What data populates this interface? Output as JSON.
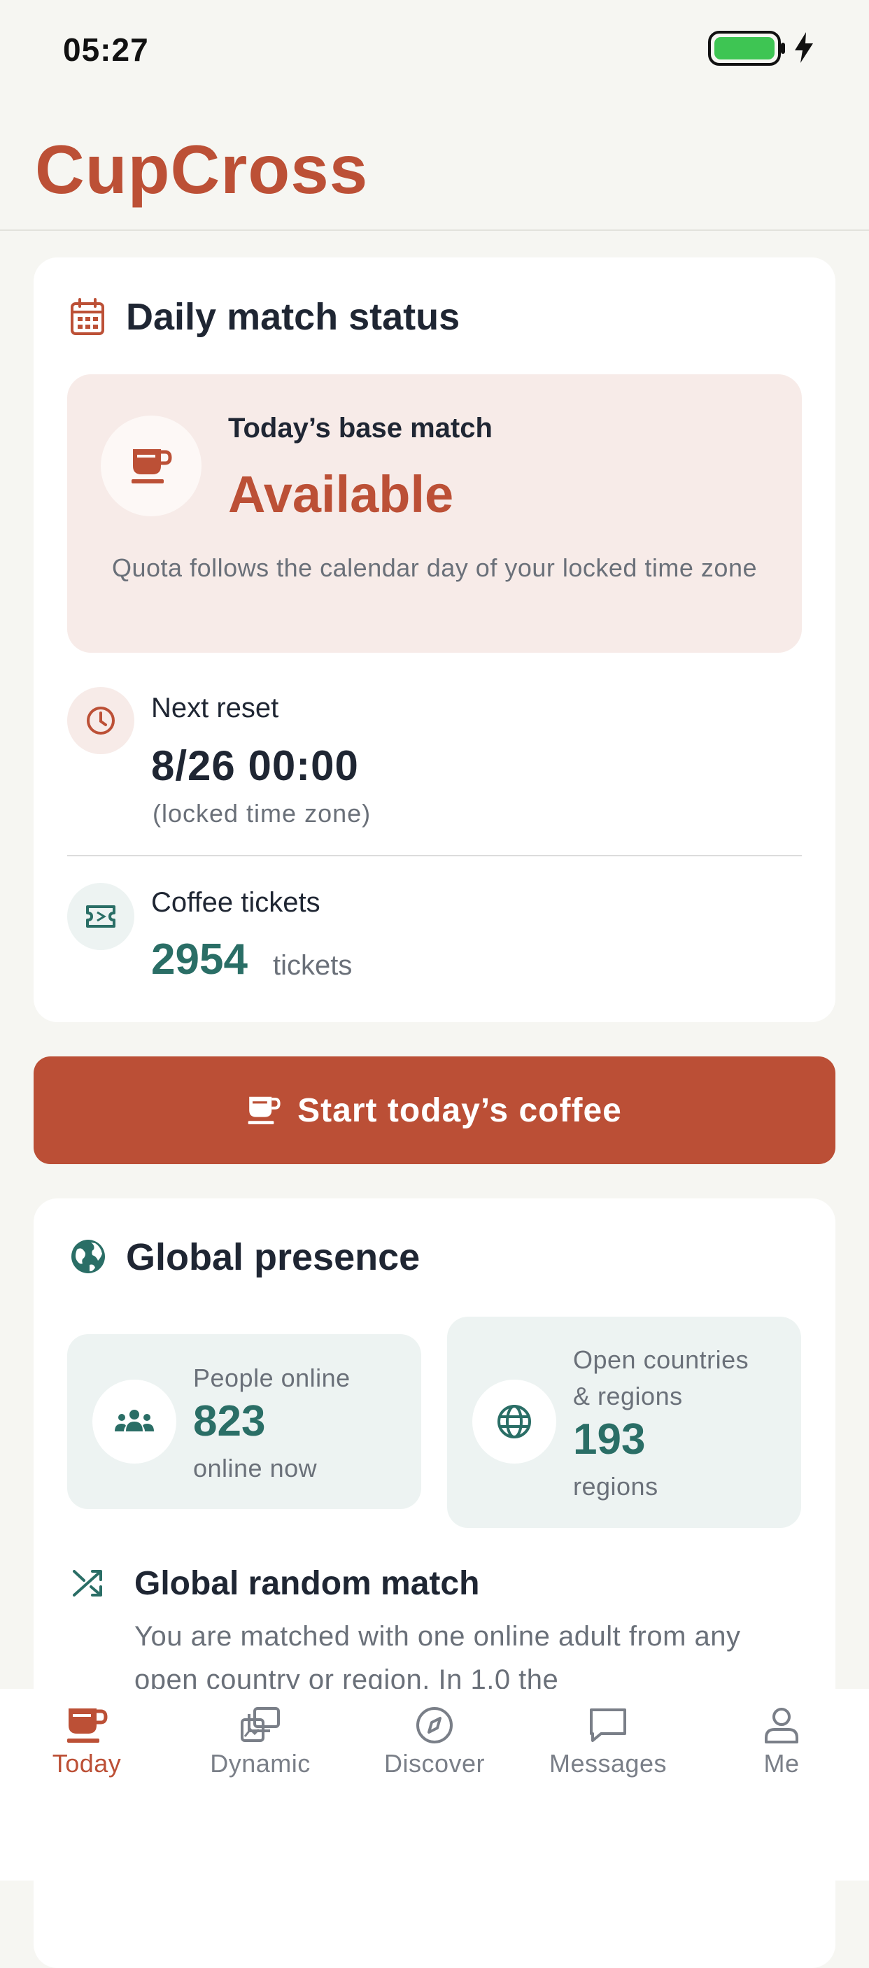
{
  "status_bar": {
    "time": "05:27"
  },
  "app": {
    "title": "CupCross"
  },
  "daily_status": {
    "title": "Daily match status",
    "base_match": {
      "label": "Today’s base match",
      "value": "Available",
      "note": "Quota follows the calendar day of your locked time zone"
    },
    "next_reset": {
      "label": "Next reset",
      "value": "8/26 00:00",
      "note": "(locked time zone)"
    },
    "coffee_tickets": {
      "label": "Coffee tickets",
      "count": "2954",
      "unit": "tickets"
    }
  },
  "cta": {
    "label": "Start today’s coffee"
  },
  "global_presence": {
    "title": "Global presence",
    "people_online": {
      "label": "People online",
      "value": "823",
      "sub": "online now"
    },
    "open_regions": {
      "label_line1": "Open countries",
      "label_line2": "& regions",
      "value": "193",
      "sub": "regions"
    },
    "random_match": {
      "title": "Global random match",
      "description": "You are matched with one online adult from any open country or region. In 1.0 the"
    }
  },
  "tabbar": {
    "items": [
      {
        "label": "Today",
        "icon": "cup-icon",
        "active": true
      },
      {
        "label": "Dynamic",
        "icon": "cards-stack-icon"
      },
      {
        "label": "Discover",
        "icon": "compass-icon"
      },
      {
        "label": "Messages",
        "icon": "chat-bubble-icon"
      },
      {
        "label": "Me",
        "icon": "person-icon"
      }
    ]
  },
  "colors": {
    "accent": "#bc5036",
    "teal": "#2a6e66",
    "background": "#f6f6f2",
    "battery": "#3ec553"
  }
}
